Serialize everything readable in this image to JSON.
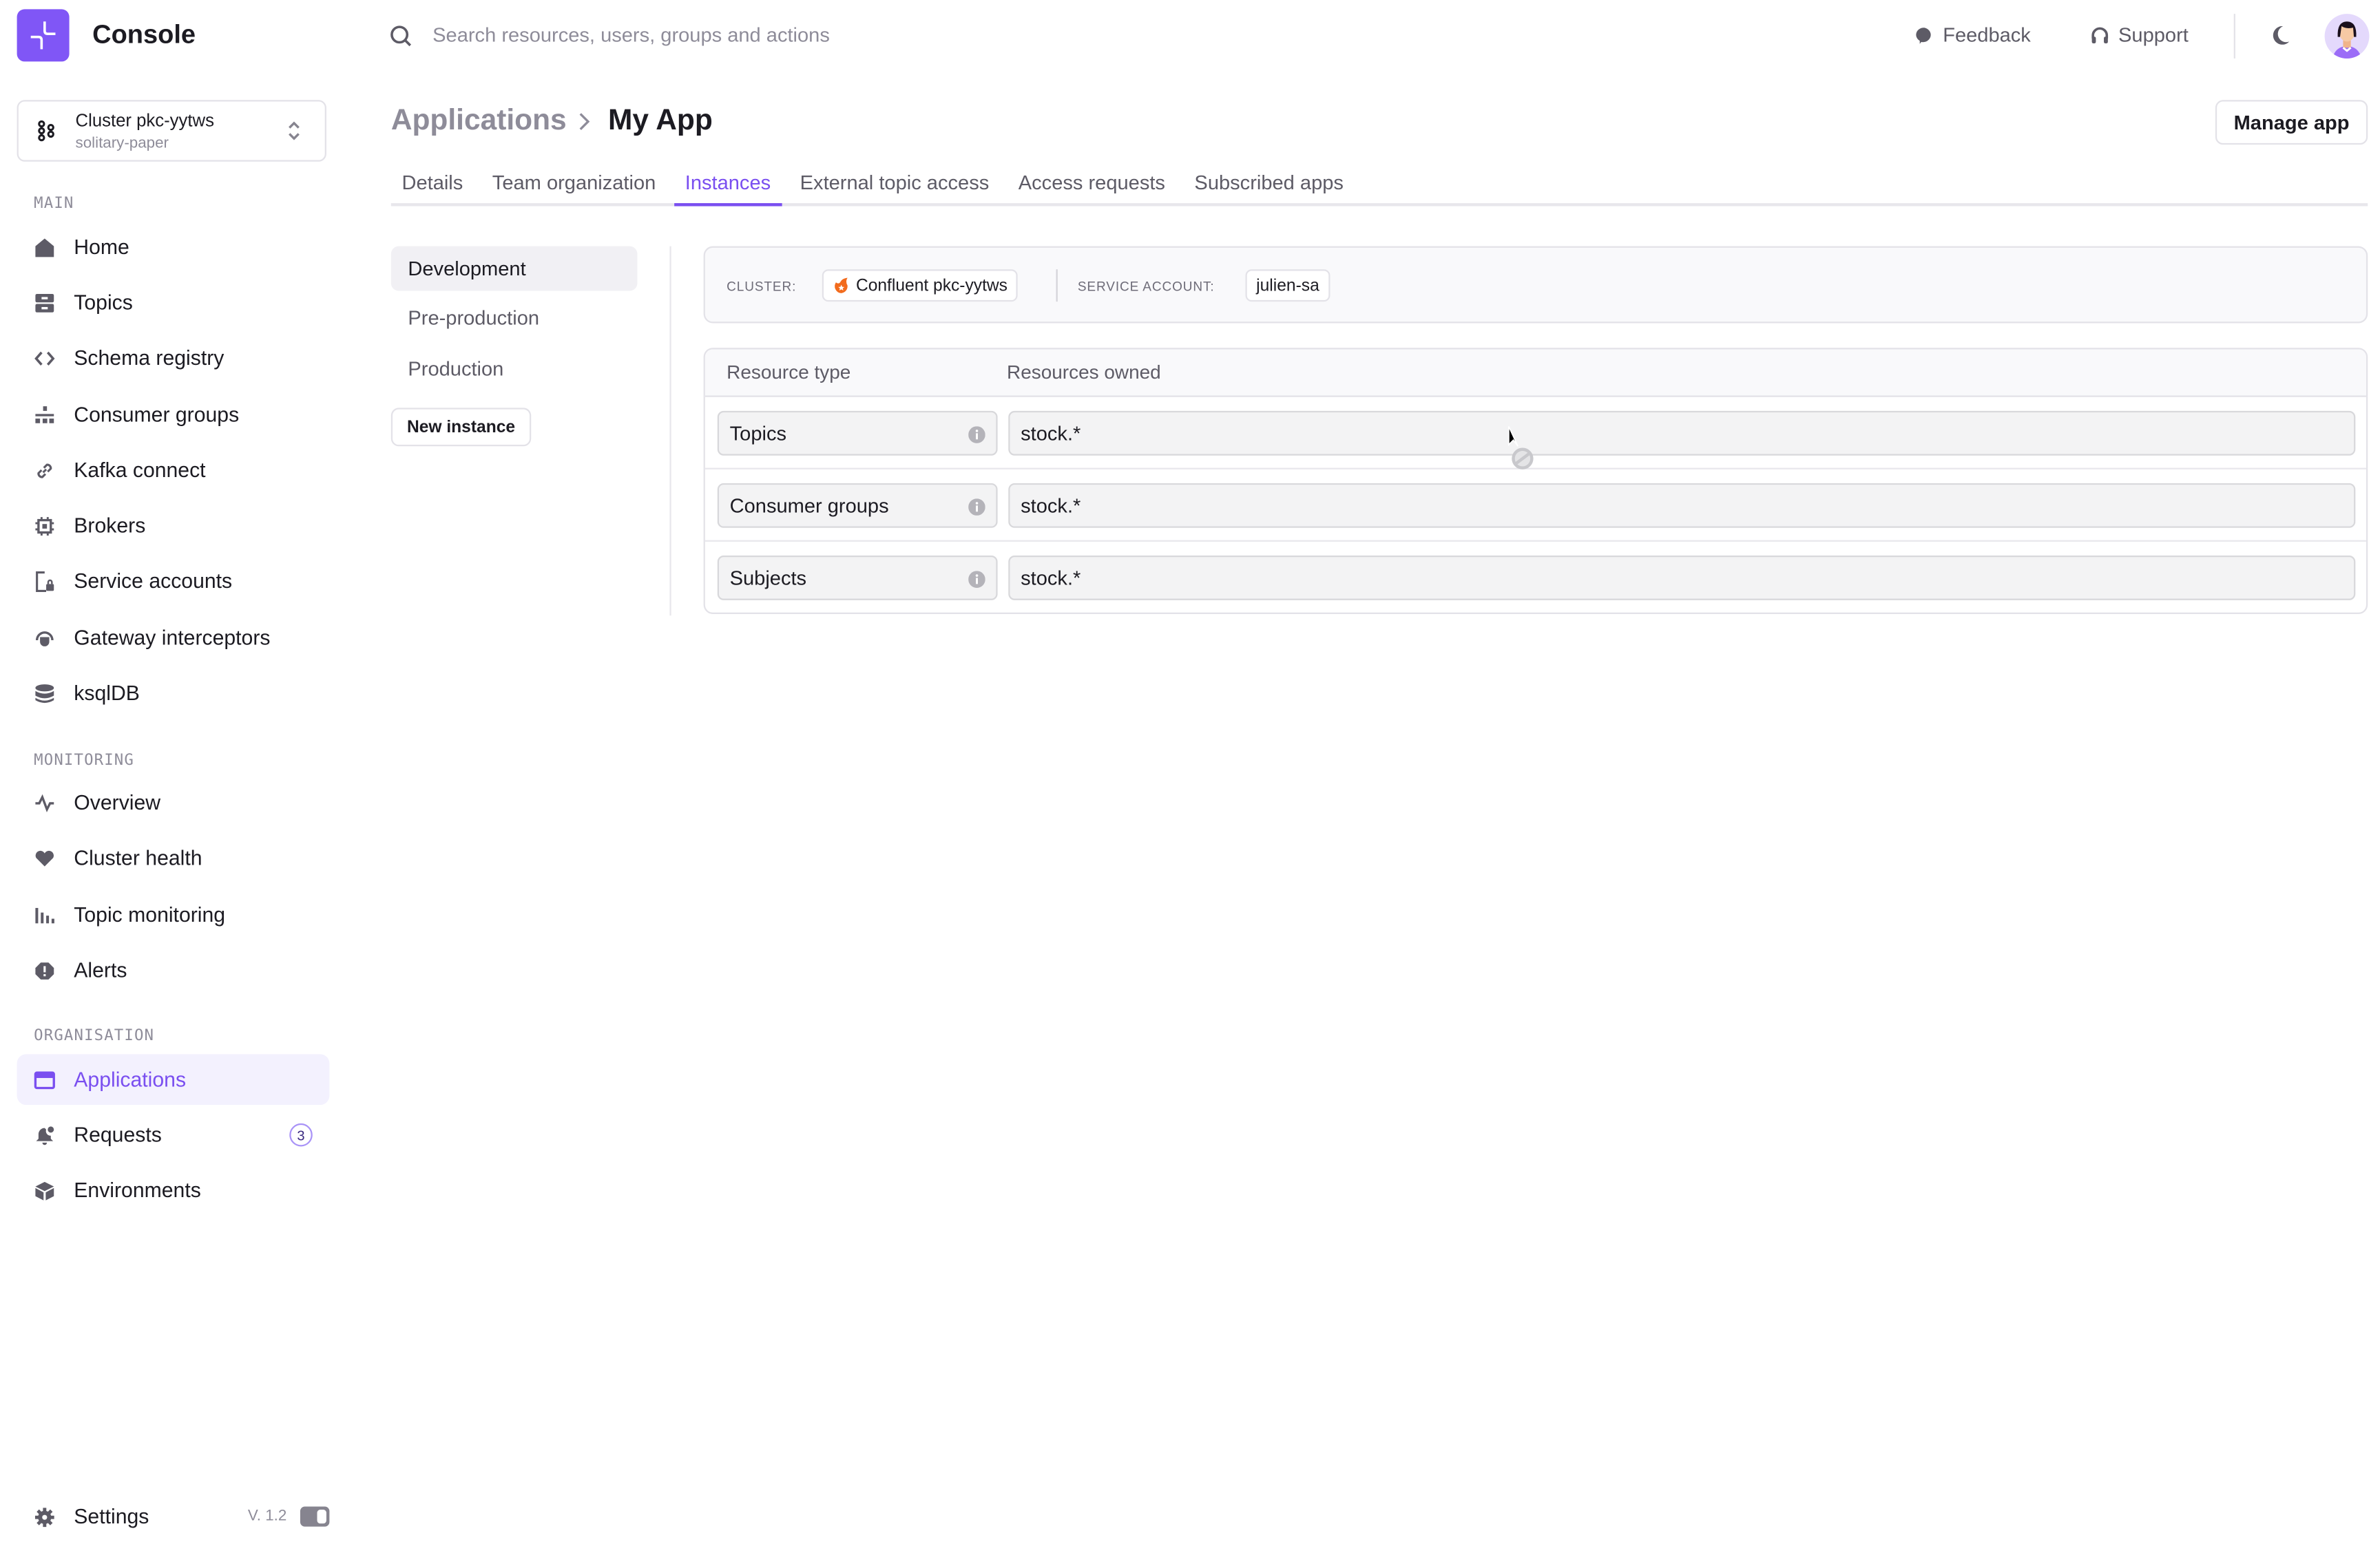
{
  "app": {
    "name": "Console"
  },
  "cluster_selector": {
    "name": "Cluster pkc-yytws",
    "subtitle": "solitary-paper"
  },
  "search": {
    "placeholder": "Search resources, users, groups and actions"
  },
  "topbar": {
    "feedback": "Feedback",
    "support": "Support",
    "theme_icon": "moon-icon",
    "avatar_icon": "avatar"
  },
  "sidebar": {
    "sections": [
      {
        "label": "MAIN",
        "items": [
          {
            "label": "Home",
            "icon": "home-icon"
          },
          {
            "label": "Topics",
            "icon": "topics-icon"
          },
          {
            "label": "Schema registry",
            "icon": "code-icon"
          },
          {
            "label": "Consumer groups",
            "icon": "hierarchy-icon"
          },
          {
            "label": "Kafka connect",
            "icon": "link-icon"
          },
          {
            "label": "Brokers",
            "icon": "chip-icon"
          },
          {
            "label": "Service accounts",
            "icon": "service-account-icon"
          },
          {
            "label": "Gateway interceptors",
            "icon": "plug-icon"
          },
          {
            "label": "ksqlDB",
            "icon": "database-icon"
          }
        ]
      },
      {
        "label": "MONITORING",
        "items": [
          {
            "label": "Overview",
            "icon": "pulse-icon"
          },
          {
            "label": "Cluster health",
            "icon": "heart-icon"
          },
          {
            "label": "Topic monitoring",
            "icon": "bar-chart-icon"
          },
          {
            "label": "Alerts",
            "icon": "alert-icon"
          }
        ]
      },
      {
        "label": "ORGANISATION",
        "items": [
          {
            "label": "Applications",
            "icon": "window-icon",
            "active": true
          },
          {
            "label": "Requests",
            "icon": "bell-icon",
            "badge": "3"
          },
          {
            "label": "Environments",
            "icon": "cube-icon"
          }
        ]
      }
    ],
    "settings": {
      "label": "Settings",
      "version": "V. 1.2"
    }
  },
  "breadcrumb": {
    "parent": "Applications",
    "current": "My App"
  },
  "header": {
    "manage_label": "Manage app"
  },
  "tabs": [
    {
      "label": "Details"
    },
    {
      "label": "Team organization"
    },
    {
      "label": "Instances",
      "active": true
    },
    {
      "label": "External topic access"
    },
    {
      "label": "Access requests"
    },
    {
      "label": "Subscribed apps"
    }
  ],
  "instances": {
    "items": [
      {
        "label": "Development",
        "active": true
      },
      {
        "label": "Pre-production"
      },
      {
        "label": "Production"
      }
    ],
    "new_label": "New instance"
  },
  "instance_info": {
    "cluster_label": "CLUSTER:",
    "cluster_value": "Confluent pkc-yytws",
    "service_account_label": "SERVICE ACCOUNT:",
    "service_account_value": "julien-sa"
  },
  "resources_table": {
    "columns": [
      "Resource type",
      "Resources owned"
    ],
    "rows": [
      {
        "type": "Topics",
        "owned": "stock.*"
      },
      {
        "type": "Consumer groups",
        "owned": "stock.*"
      },
      {
        "type": "Subjects",
        "owned": "stock.*"
      }
    ]
  },
  "colors": {
    "accent": "#7a4ff0",
    "logo": "#8056f6",
    "confluent": "#f26b1d"
  }
}
